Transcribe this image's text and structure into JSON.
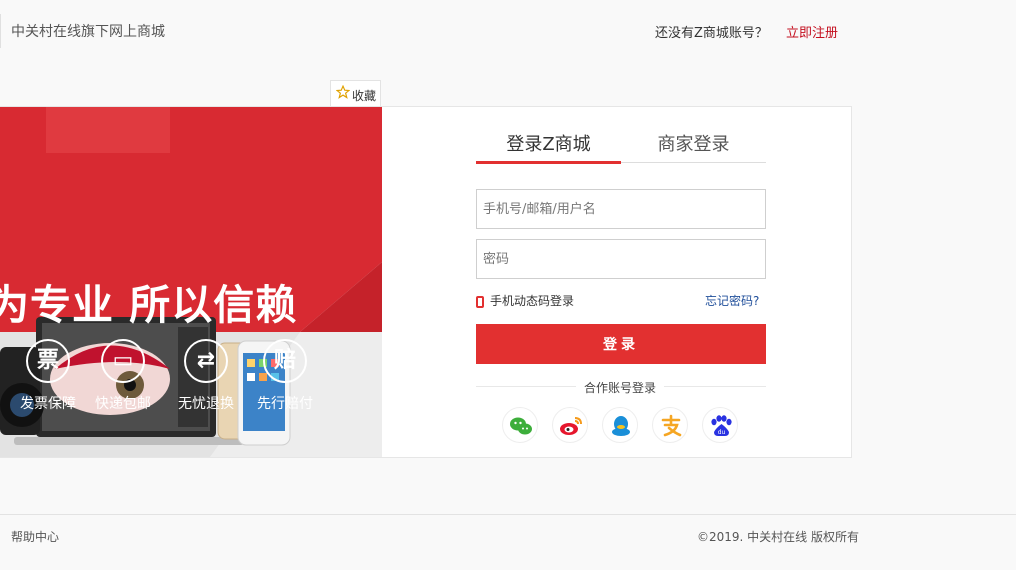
{
  "header": {
    "site_name": "中关村在线旗下网上商城",
    "register_prompt": "还没有Z商城账号？",
    "register_link": "立即注册"
  },
  "favorite": {
    "icon": "star-icon",
    "label": "收藏"
  },
  "banner": {
    "slogan": "为专业 所以信赖",
    "features": [
      {
        "icon_char": "票",
        "label": "发票保障"
      },
      {
        "icon_char": "▭",
        "label": "快递包邮"
      },
      {
        "icon_char": "⇄",
        "label": "无忧退换"
      },
      {
        "icon_char": "赔",
        "label": "先行赔付"
      }
    ],
    "colors": {
      "red": "#d82a32"
    }
  },
  "login": {
    "tabs": [
      {
        "label": "登录Z商城",
        "active": true
      },
      {
        "label": "商家登录",
        "active": false
      }
    ],
    "username_placeholder": "手机号/邮箱/用户名",
    "password_placeholder": "密码",
    "phone_login_label": "手机动态码登录",
    "forgot_label": "忘记密码?",
    "submit_label": "登录",
    "partner_label": "合作账号登录",
    "partners": [
      "wechat-icon",
      "weibo-icon",
      "qq-icon",
      "alipay-icon",
      "baidu-icon"
    ],
    "accent_color": "#e23030"
  },
  "footer": {
    "help_label": "帮助中心",
    "copyright": "©2019. 中关村在线 版权所有"
  }
}
